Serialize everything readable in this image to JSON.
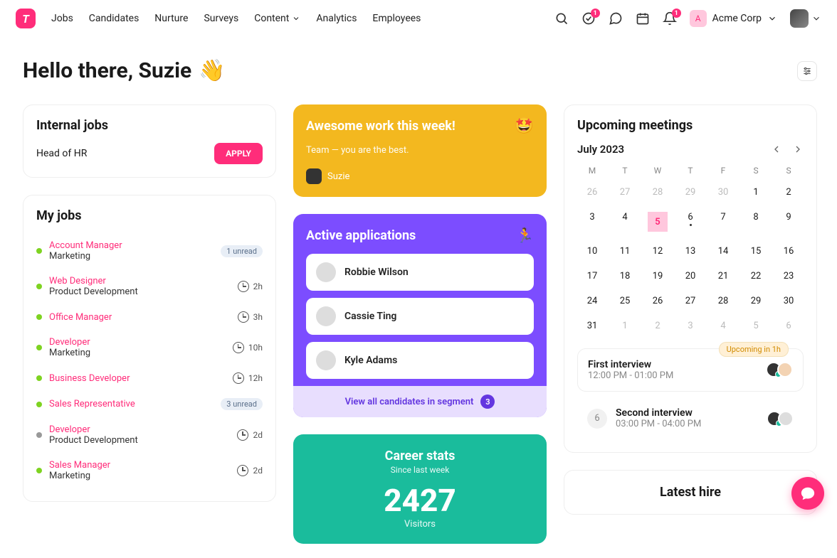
{
  "nav": {
    "items": [
      "Jobs",
      "Candidates",
      "Nurture",
      "Surveys",
      "Content",
      "Analytics",
      "Employees"
    ]
  },
  "top": {
    "badge1": "1",
    "badge2": "1",
    "org": "Acme Corp"
  },
  "hero": {
    "greeting": "Hello there, Suzie"
  },
  "internal": {
    "title": "Internal jobs",
    "job": "Head of HR",
    "apply": "APPLY"
  },
  "myjobs": {
    "title": "My jobs",
    "items": [
      {
        "title": "Account Manager",
        "dept": "Marketing",
        "status": "green",
        "meta_type": "unread",
        "meta": "1 unread"
      },
      {
        "title": "Web Designer",
        "dept": "Product Development",
        "status": "green",
        "meta_type": "time",
        "meta": "2h"
      },
      {
        "title": "Office Manager",
        "dept": "",
        "status": "green",
        "meta_type": "time",
        "meta": "3h"
      },
      {
        "title": "Developer",
        "dept": "Marketing",
        "status": "green",
        "meta_type": "time",
        "meta": "10h"
      },
      {
        "title": "Business Developer",
        "dept": "",
        "status": "green",
        "meta_type": "time",
        "meta": "12h"
      },
      {
        "title": "Sales Representative",
        "dept": "",
        "status": "green",
        "meta_type": "unread",
        "meta": "3 unread"
      },
      {
        "title": "Developer",
        "dept": "Product Development",
        "status": "gray",
        "meta_type": "time",
        "meta": "2d"
      },
      {
        "title": "Sales Manager",
        "dept": "Marketing",
        "status": "green",
        "meta_type": "time",
        "meta": "2d"
      }
    ]
  },
  "praise": {
    "title": "Awesome work this week!",
    "body": "Team — you are the best.",
    "author": "Suzie"
  },
  "apps": {
    "title": "Active applications",
    "items": [
      "Robbie Wilson",
      "Cassie Ting",
      "Kyle Adams"
    ],
    "footer": "View all candidates in segment",
    "count": "3"
  },
  "stats": {
    "title": "Career stats",
    "sub": "Since last week",
    "value": "2427",
    "label": "Visitors"
  },
  "upcoming": {
    "title": "Upcoming meetings",
    "month": "July 2023",
    "dow": [
      "M",
      "T",
      "W",
      "T",
      "F",
      "S",
      "S"
    ],
    "prev_days": [
      "26",
      "27",
      "28",
      "29",
      "30",
      "1",
      "2"
    ],
    "rows": [
      [
        "3",
        "4",
        "5",
        "6",
        "7",
        "8",
        "9"
      ],
      [
        "10",
        "11",
        "12",
        "13",
        "14",
        "15",
        "16"
      ],
      [
        "17",
        "18",
        "19",
        "20",
        "21",
        "22",
        "23"
      ],
      [
        "24",
        "25",
        "26",
        "27",
        "28",
        "29",
        "30"
      ]
    ],
    "last_row": [
      "31",
      "1",
      "2",
      "3",
      "4",
      "5",
      "6"
    ],
    "selected": "5",
    "pill": "Upcoming in 1h",
    "m1_title": "First interview",
    "m1_time": "12:00 PM - 01:00 PM",
    "m2_num": "6",
    "m2_title": "Second interview",
    "m2_time": "03:00 PM - 04:00 PM"
  },
  "latest": {
    "title": "Latest hire"
  }
}
